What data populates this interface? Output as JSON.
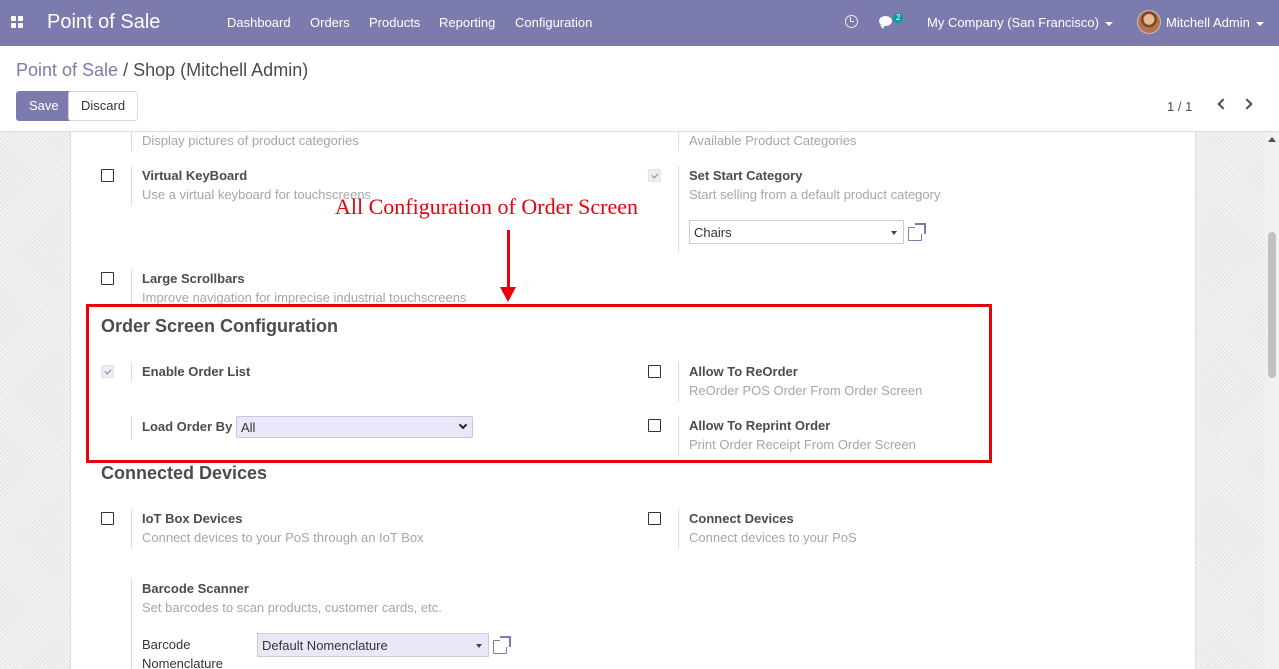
{
  "navbar": {
    "app_name": "Point of Sale",
    "menu": [
      "Dashboard",
      "Orders",
      "Products",
      "Reporting",
      "Configuration"
    ],
    "chat_count": "2",
    "company": "My Company (San Francisco)",
    "user": "Mitchell Admin",
    "colors": {
      "navbar": "#7c7bad"
    }
  },
  "control": {
    "breadcrumb_parent": "Point of Sale",
    "breadcrumb_sep": "/",
    "breadcrumb_current": "Shop (Mitchell Admin)",
    "save": "Save",
    "discard": "Discard",
    "pager": "1 / 1"
  },
  "settings": {
    "category_pictures_desc": "Display pictures of product categories",
    "available_categories_desc": "Available Product Categories",
    "virtual_keyboard": {
      "title": "Virtual KeyBoard",
      "desc": "Use a virtual keyboard for touchscreens",
      "checked": false
    },
    "start_category": {
      "title": "Set Start Category",
      "desc": "Start selling from a default product category",
      "checked": true,
      "value": "Chairs"
    },
    "large_scrollbars": {
      "title": "Large Scrollbars",
      "desc": "Improve navigation for imprecise industrial touchscreens",
      "checked": false
    }
  },
  "order_screen": {
    "section_title": "Order Screen Configuration",
    "enable_order_list": {
      "title": "Enable Order List",
      "checked": true
    },
    "load_order_by": {
      "label": "Load Order By",
      "value": "All"
    },
    "allow_reorder": {
      "title": "Allow To ReOrder",
      "desc": "ReOrder POS Order From Order Screen",
      "checked": false
    },
    "allow_reprint": {
      "title": "Allow To Reprint Order",
      "desc": "Print Order Receipt From Order Screen",
      "checked": false
    }
  },
  "connected_devices": {
    "section_title": "Connected Devices",
    "iot_box": {
      "title": "IoT Box Devices",
      "desc": "Connect devices to your PoS through an IoT Box",
      "checked": false
    },
    "connect_devices": {
      "title": "Connect Devices",
      "desc": "Connect devices to your PoS",
      "checked": false
    },
    "barcode_scanner": {
      "title": "Barcode Scanner",
      "desc": "Set barcodes to scan products, customer cards, etc.",
      "nomenclature_label": "Barcode Nomenclature",
      "nomenclature_value": "Default Nomenclature"
    }
  },
  "annotation": {
    "text": "All Configuration of Order Screen",
    "color": "#e8000d"
  }
}
